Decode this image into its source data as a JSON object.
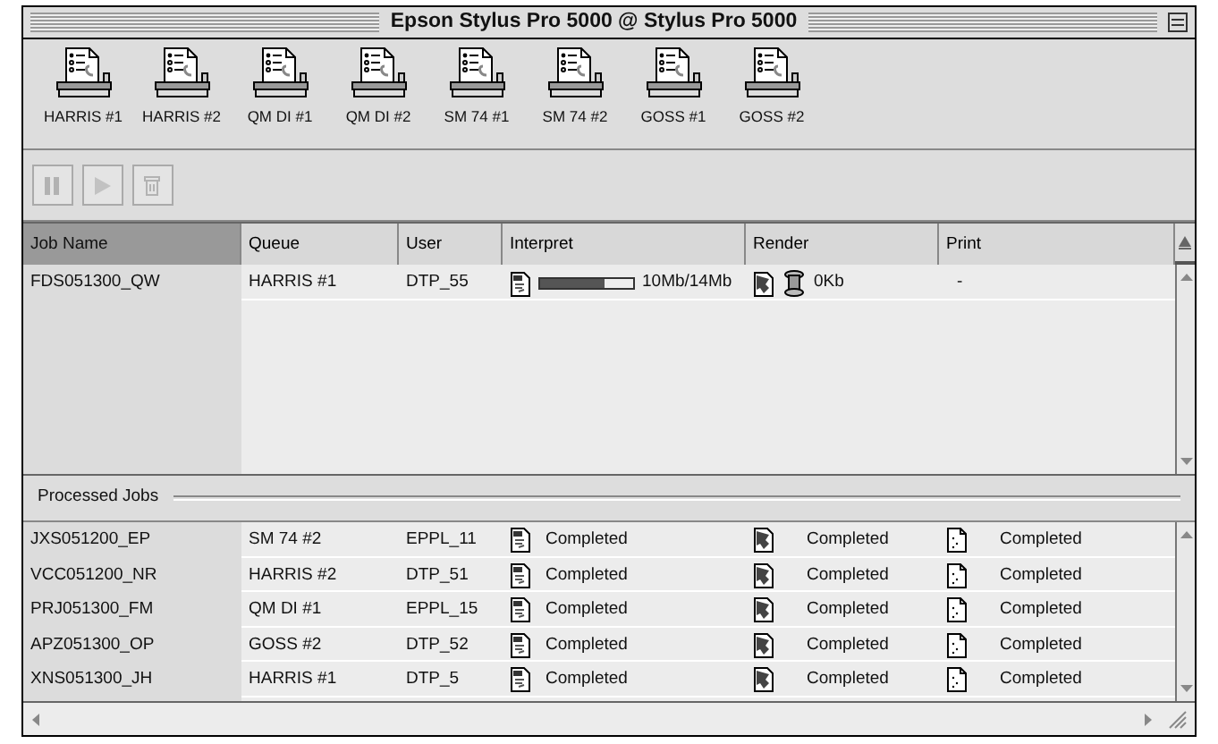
{
  "window": {
    "title": "Epson Stylus Pro 5000 @ Stylus Pro 5000"
  },
  "queues": [
    {
      "label": "HARRIS #1"
    },
    {
      "label": "HARRIS #2"
    },
    {
      "label": "QM DI #1"
    },
    {
      "label": "QM DI #2"
    },
    {
      "label": "SM 74 #1"
    },
    {
      "label": "SM 74 #2"
    },
    {
      "label": "GOSS #1"
    },
    {
      "label": "GOSS #2"
    }
  ],
  "toolbar": [
    {
      "kind": "pause",
      "disabled": true
    },
    {
      "kind": "play",
      "disabled": true
    },
    {
      "kind": "trash",
      "disabled": true
    }
  ],
  "columns": [
    {
      "label": "Job Name",
      "selected": true
    },
    {
      "label": "Queue",
      "selected": false
    },
    {
      "label": "User",
      "selected": false
    },
    {
      "label": "Interpret",
      "selected": false
    },
    {
      "label": "Render",
      "selected": false
    },
    {
      "label": "Print",
      "selected": false
    }
  ],
  "active_jobs": [
    {
      "job_name": "FDS051300_QW",
      "queue": "HARRIS #1",
      "user": "DTP_55",
      "interpret": {
        "level": 0.7,
        "reading": "10Mb/14Mb"
      },
      "render": "0Kb",
      "print": "-"
    }
  ],
  "processed": {
    "label": "Processed Jobs",
    "rows": [
      {
        "job_name": "JXS051200_EP",
        "queue": "SM 74 #2",
        "user": "EPPL_11",
        "interpret": "Completed",
        "render": "Completed",
        "print": "Completed"
      },
      {
        "job_name": "VCC051200_NR",
        "queue": "HARRIS #2",
        "user": "DTP_51",
        "interpret": "Completed",
        "render": "Completed",
        "print": "Completed"
      },
      {
        "job_name": "PRJ051300_FM",
        "queue": "QM DI #1",
        "user": "EPPL_15",
        "interpret": "Completed",
        "render": "Completed",
        "print": "Completed"
      },
      {
        "job_name": "APZ051300_OP",
        "queue": "GOSS #2",
        "user": "DTP_52",
        "interpret": "Completed",
        "render": "Completed",
        "print": "Completed"
      },
      {
        "job_name": "XNS051300_JH",
        "queue": "HARRIS #1",
        "user": "DTP_5",
        "interpret": "Completed",
        "render": "Completed",
        "print": "Completed"
      }
    ]
  }
}
